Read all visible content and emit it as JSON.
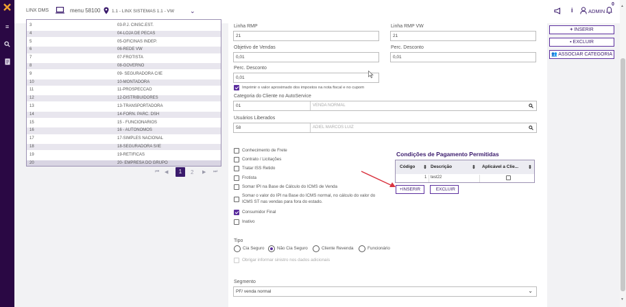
{
  "colors": {
    "sidebar": "#2a0844",
    "accent": "#5b2d9e",
    "arrow": "#d9333f"
  },
  "sidebar": {
    "icons": [
      "logo-icon",
      "menu-icon",
      "search-icon",
      "document-icon"
    ]
  },
  "topbar": {
    "app_name": "LINX DMS",
    "menu_label": "menu 58100",
    "location": "1.1 - LINX SISTEMAS 1.1 - VW",
    "user": "ADMIN",
    "notification_badge": "0"
  },
  "table": {
    "rows": [
      {
        "num": "3",
        "desc": "03-P.J. CINSC.EST."
      },
      {
        "num": "4",
        "desc": "04-LOJA DE PECAS"
      },
      {
        "num": "5",
        "desc": "05-OFICINAS INDEP."
      },
      {
        "num": "6",
        "desc": "06-REDE VW"
      },
      {
        "num": "7",
        "desc": "07-FROTISTA"
      },
      {
        "num": "8",
        "desc": "08-GOVERNO"
      },
      {
        "num": "9",
        "desc": "09- SEGURADORA C/IE"
      },
      {
        "num": "10",
        "desc": "10-MONTADORA"
      },
      {
        "num": "11",
        "desc": "11-PROSPECCAO"
      },
      {
        "num": "12",
        "desc": "12-DISTRIBUIDORES"
      },
      {
        "num": "13",
        "desc": "13-TRANSPORTADORA"
      },
      {
        "num": "14",
        "desc": "14-FORN. PARC. DSH"
      },
      {
        "num": "15",
        "desc": "15 - FUNCIONARIOS"
      },
      {
        "num": "16",
        "desc": "16 - AUTONOMOS"
      },
      {
        "num": "17",
        "desc": "17-SIMPLES NACIONAL"
      },
      {
        "num": "18",
        "desc": "18-SEGURADORA S/IE"
      },
      {
        "num": "19",
        "desc": "19-RETIFICAS"
      },
      {
        "num": "20",
        "desc": "20- EMPRESA DO GRUPO"
      }
    ],
    "pager": {
      "first": "⏮",
      "prev": "◀",
      "page1": "1",
      "page2": "2",
      "next": "▶",
      "last": "⏭"
    }
  },
  "form": {
    "linha_rmp": {
      "label": "Linha RMP",
      "value": "21"
    },
    "linha_rmp_vw": {
      "label": "Linha RMP VW",
      "value": "21"
    },
    "objetivo_vendas": {
      "label": "Objetivo de Vendas",
      "value": "0,01"
    },
    "perc_desconto_1": {
      "label": "Perc. Desconto",
      "value": "0,01"
    },
    "perc_desconto_2": {
      "label": "Perc. Desconto",
      "value": "0,01"
    },
    "imprimir_impostos": "Imprimir o valor aproximado dos impostos na nota fiscal e no cupom",
    "categoria": {
      "label": "Categoria do Cliente no AutoService",
      "code": "01",
      "desc": "VENDA NORMAL"
    },
    "usuarios": {
      "label": "Usuários Liberados",
      "code": "58",
      "desc": "ADIEL MARCOS LUIZ"
    },
    "checkboxes": [
      {
        "label": "Conhecimento de Frete",
        "checked": false
      },
      {
        "label": "Contrato / Licitações",
        "checked": false
      },
      {
        "label": "Tratar ISS Retido",
        "checked": false
      },
      {
        "label": "Frotista",
        "checked": false
      },
      {
        "label": "Somar IPI na Base de Cálculo do ICMS de Venda",
        "checked": false
      },
      {
        "label": "Somar o valor do IPI na Base do ICMS normal, no cálculo do valor do",
        "label2": "ICMS ST nas vendas para fora do estado.",
        "checked": false
      },
      {
        "label": "Consumidor Final",
        "checked": true
      },
      {
        "label": "Inativo",
        "checked": false
      }
    ],
    "tipo": {
      "label": "Tipo",
      "options": [
        "Cia Seguro",
        "Não Cia Seguro",
        "Cliente Revenda",
        "Funcionário"
      ],
      "selected": "Não Cia Seguro"
    },
    "obrigar_sinistro": "Obrigar informar sinistro nos dados adicionais",
    "segmento": {
      "label": "Segmento",
      "value": "PF/ venda normal"
    }
  },
  "condicoes": {
    "title": "Condições de Pagamento Permitidas",
    "headers": [
      "Código",
      "Descrição",
      "Aplicável a Clie..."
    ],
    "rows": [
      {
        "codigo": "1",
        "descricao": "test22"
      }
    ],
    "inserir": "+INSERIR",
    "excluir": "EXCLUIR"
  },
  "actions": {
    "inserir": "INSERIR",
    "excluir": "EXCLUIR",
    "associar": "ASSOCIAR CATEGORIA"
  }
}
